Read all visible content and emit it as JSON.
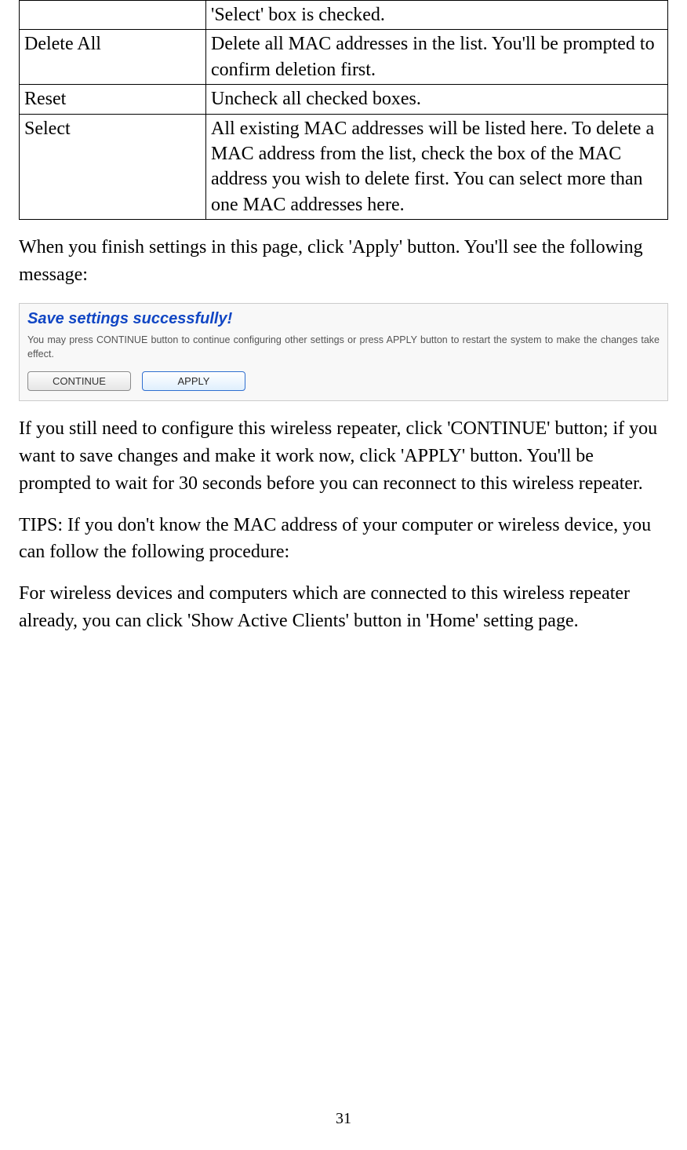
{
  "table": {
    "rows": [
      {
        "left": "",
        "right": "'Select' box is checked."
      },
      {
        "left": "Delete All",
        "right": "Delete all MAC addresses in the list. You'll be prompted to confirm deletion first."
      },
      {
        "left": "Reset",
        "right": "Uncheck all checked boxes."
      },
      {
        "left": "Select",
        "right": "All existing MAC addresses will be listed here. To delete a MAC address from the list, check the box of the MAC address you wish to delete first. You can select more than one MAC addresses here."
      }
    ]
  },
  "para1": "When you finish settings in this page, click 'Apply' button. You'll see the following message:",
  "panel": {
    "title": "Save settings successfully!",
    "desc": "You may press CONTINUE button to continue configuring other settings or press APPLY button to restart the system to make the changes take effect.",
    "continue_label": "CONTINUE",
    "apply_label": "APPLY"
  },
  "para2": "If you still need to configure this wireless repeater, click 'CONTINUE' button; if you want to save changes and make it work now, click 'APPLY' button. You'll be prompted to wait for 30 seconds before you can reconnect to this wireless repeater.",
  "para3": "TIPS: If you don't know the MAC address of your computer or wireless device, you can follow the following procedure:",
  "para4": "For wireless devices and computers which are connected to this wireless repeater already, you can click 'Show Active Clients' button in 'Home' setting page.",
  "page_number": "31"
}
